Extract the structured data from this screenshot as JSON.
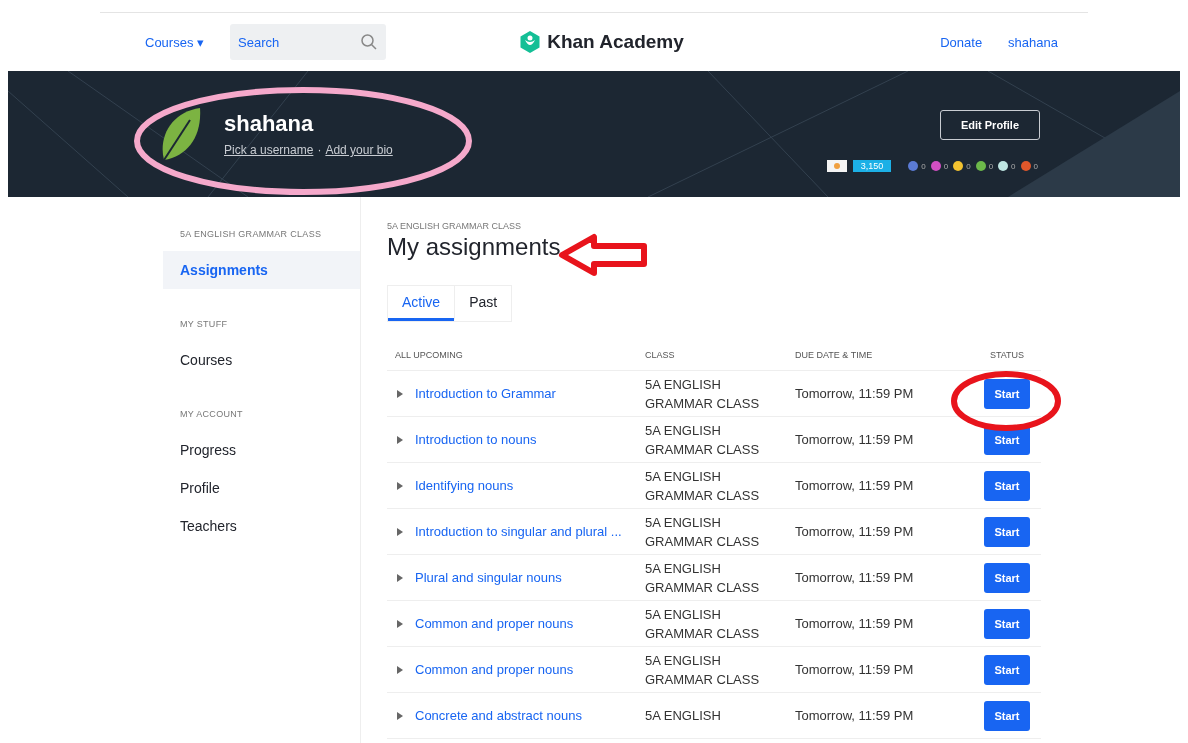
{
  "nav": {
    "courses": "Courses",
    "caret": "▾",
    "search": {
      "placeholder": "Search"
    },
    "logo": "Khan Academy",
    "donate": "Donate",
    "user": "shahana"
  },
  "profile": {
    "name": "shahana",
    "pick_username": "Pick a username",
    "separator": "·",
    "add_bio": "Add your bio",
    "edit_button": "Edit Profile",
    "points": "3,150",
    "badges": [
      {
        "color": "#5b7bd5",
        "count": "0"
      },
      {
        "color": "#d14fc2",
        "count": "0"
      },
      {
        "color": "#f2c230",
        "count": "0"
      },
      {
        "color": "#6cb84a",
        "count": "0"
      },
      {
        "color": "#bfe6e2",
        "count": "0"
      },
      {
        "color": "#e0572b",
        "count": "0"
      }
    ]
  },
  "sidebar": {
    "sections": [
      {
        "heading": "5A ENGLISH GRAMMAR CLASS",
        "items": [
          {
            "label": "Assignments",
            "selected": true
          }
        ]
      },
      {
        "heading": "MY STUFF",
        "items": [
          {
            "label": "Courses",
            "selected": false
          }
        ]
      },
      {
        "heading": "MY ACCOUNT",
        "items": [
          {
            "label": "Progress",
            "selected": false
          },
          {
            "label": "Profile",
            "selected": false
          },
          {
            "label": "Teachers",
            "selected": false
          }
        ]
      }
    ]
  },
  "main": {
    "class_label": "5A ENGLISH GRAMMAR CLASS",
    "title": "My assignments",
    "tabs": [
      {
        "label": "Active",
        "selected": true
      },
      {
        "label": "Past",
        "selected": false
      }
    ],
    "table": {
      "columns": [
        "ALL UPCOMING",
        "CLASS",
        "DUE DATE & TIME",
        "STATUS"
      ],
      "rows": [
        {
          "name": "Introduction to Grammar",
          "class": [
            "5A ENGLISH",
            "GRAMMAR CLASS"
          ],
          "due": "Tomorrow, 11:59 PM",
          "action": "Start"
        },
        {
          "name": "Introduction to nouns",
          "class": [
            "5A ENGLISH",
            "GRAMMAR CLASS"
          ],
          "due": "Tomorrow, 11:59 PM",
          "action": "Start"
        },
        {
          "name": "Identifying nouns",
          "class": [
            "5A ENGLISH",
            "GRAMMAR CLASS"
          ],
          "due": "Tomorrow, 11:59 PM",
          "action": "Start"
        },
        {
          "name": "Introduction to singular and plural ...",
          "class": [
            "5A ENGLISH",
            "GRAMMAR CLASS"
          ],
          "due": "Tomorrow, 11:59 PM",
          "action": "Start"
        },
        {
          "name": "Plural and singular nouns",
          "class": [
            "5A ENGLISH",
            "GRAMMAR CLASS"
          ],
          "due": "Tomorrow, 11:59 PM",
          "action": "Start"
        },
        {
          "name": "Common and proper nouns",
          "class": [
            "5A ENGLISH",
            "GRAMMAR CLASS"
          ],
          "due": "Tomorrow, 11:59 PM",
          "action": "Start"
        },
        {
          "name": "Common and proper nouns",
          "class": [
            "5A ENGLISH",
            "GRAMMAR CLASS"
          ],
          "due": "Tomorrow, 11:59 PM",
          "action": "Start"
        },
        {
          "name": "Concrete and abstract nouns",
          "class": [
            "5A ENGLISH"
          ],
          "due": "Tomorrow, 11:59 PM",
          "action": "Start"
        }
      ]
    }
  },
  "annotations": [
    {
      "kind": "ellipse",
      "color": "#f5a9cb"
    },
    {
      "kind": "arrow",
      "color": "#e8141c"
    },
    {
      "kind": "ellipse",
      "color": "#e8141c"
    }
  ]
}
